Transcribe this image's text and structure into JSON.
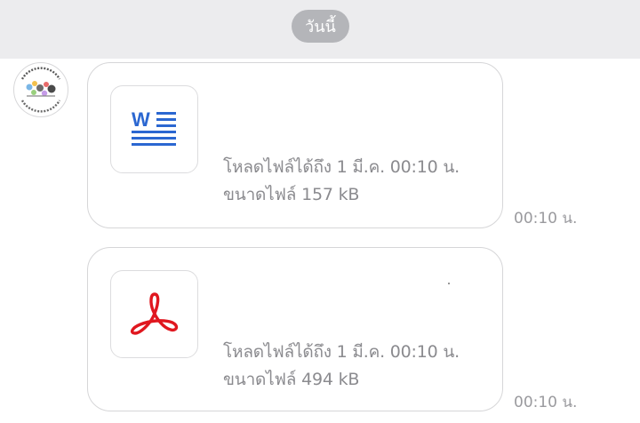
{
  "date_separator": "วันนี้",
  "colors": {
    "background": "#ffffff",
    "header_background": "#ececee",
    "pill": "#b4b5b9",
    "word_blue": "#2b67d1",
    "pdf_red": "#e0171f",
    "meta_text": "#8b8b8f"
  },
  "messages": [
    {
      "icon": "word-document-icon",
      "expire_text": "โหลดไฟล์ได้ถึง 1 มี.ค. 00:10 น.",
      "size_text": "ขนาดไฟล์ 157 kB",
      "time": "00:10 น."
    },
    {
      "icon": "pdf-document-icon",
      "expire_text": "โหลดไฟล์ได้ถึง 1 มี.ค. 00:10 น.",
      "size_text": "ขนาดไฟล์ 494 kB",
      "time": "00:10 น."
    }
  ]
}
